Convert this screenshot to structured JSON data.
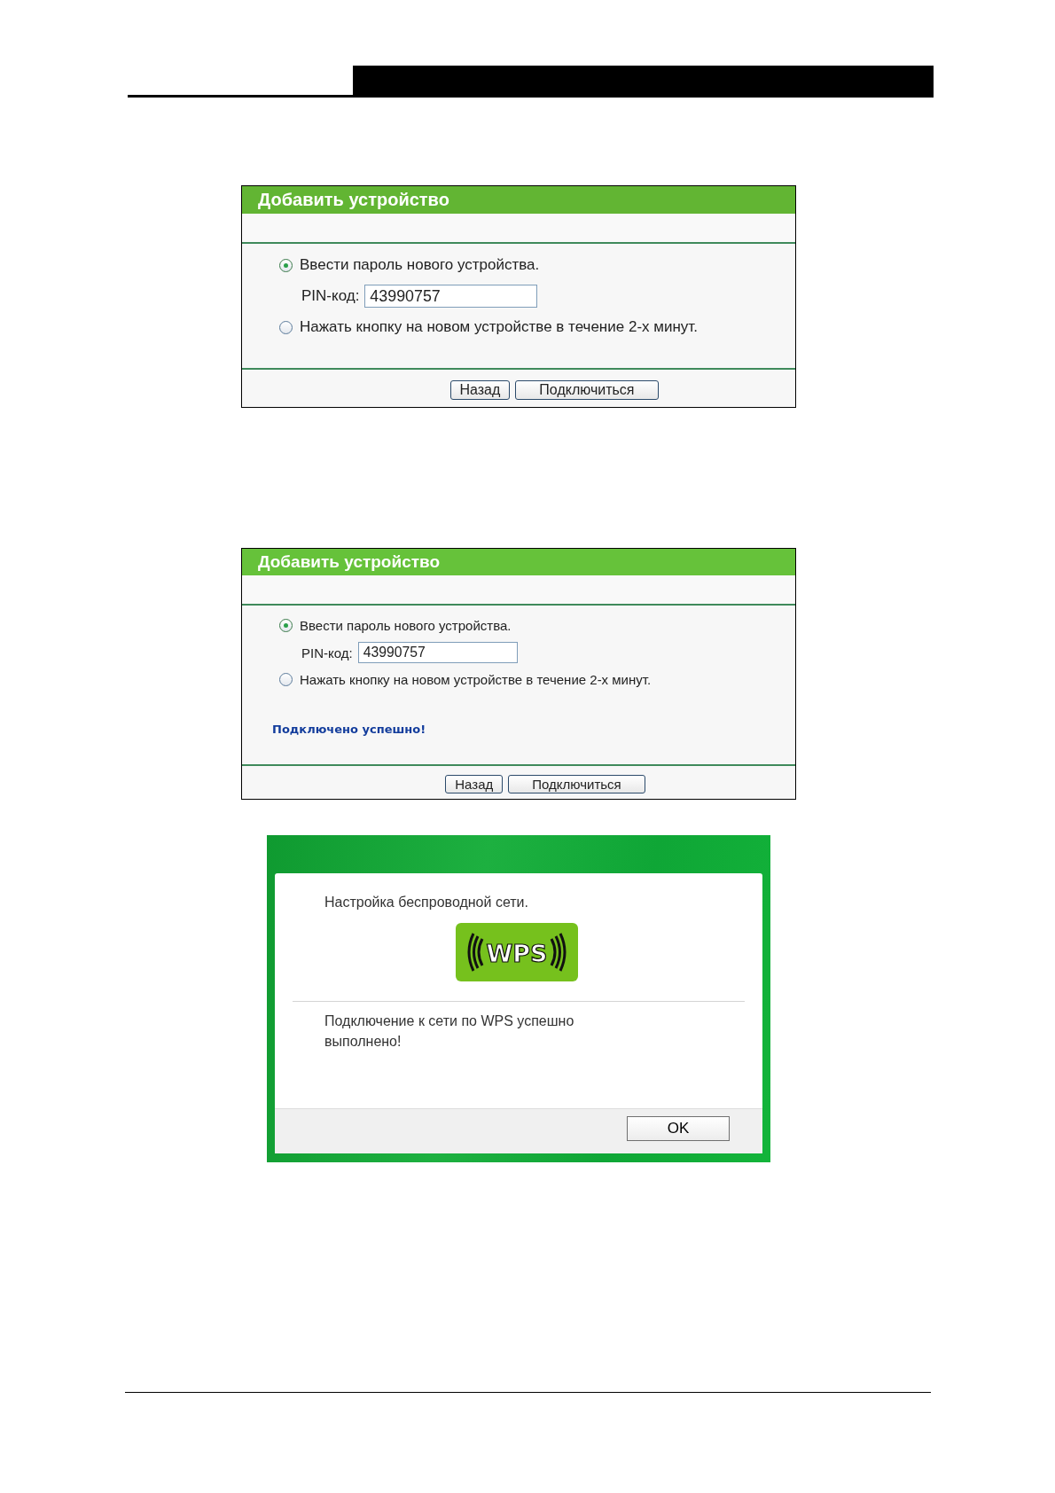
{
  "panels": [
    {
      "title": "Добавить устройство",
      "options": [
        {
          "label": "Ввести пароль нового устройства.",
          "selected": true
        },
        {
          "label": "Нажать кнопку на новом устройстве в течение 2-х минут.",
          "selected": false
        }
      ],
      "pin_label": "PIN-код:",
      "pin_value": "43990757",
      "buttons": [
        "Назад",
        "Подключиться"
      ]
    },
    {
      "title": "Добавить устройство",
      "options": [
        {
          "label": "Ввести пароль нового устройства.",
          "selected": true
        },
        {
          "label": "Нажать кнопку на новом устройстве в течение 2-х минут.",
          "selected": false
        }
      ],
      "pin_label": "PIN-код:",
      "pin_value": "43990757",
      "status": "Подключено успешно!",
      "buttons": [
        "Назад",
        "Подключиться"
      ]
    }
  ],
  "dialog": {
    "heading": "Настройка беспроводной сети.",
    "logo_text": "WPS",
    "message": "Подключение к сети по WPS успешно выполнено!",
    "button": "OK"
  }
}
